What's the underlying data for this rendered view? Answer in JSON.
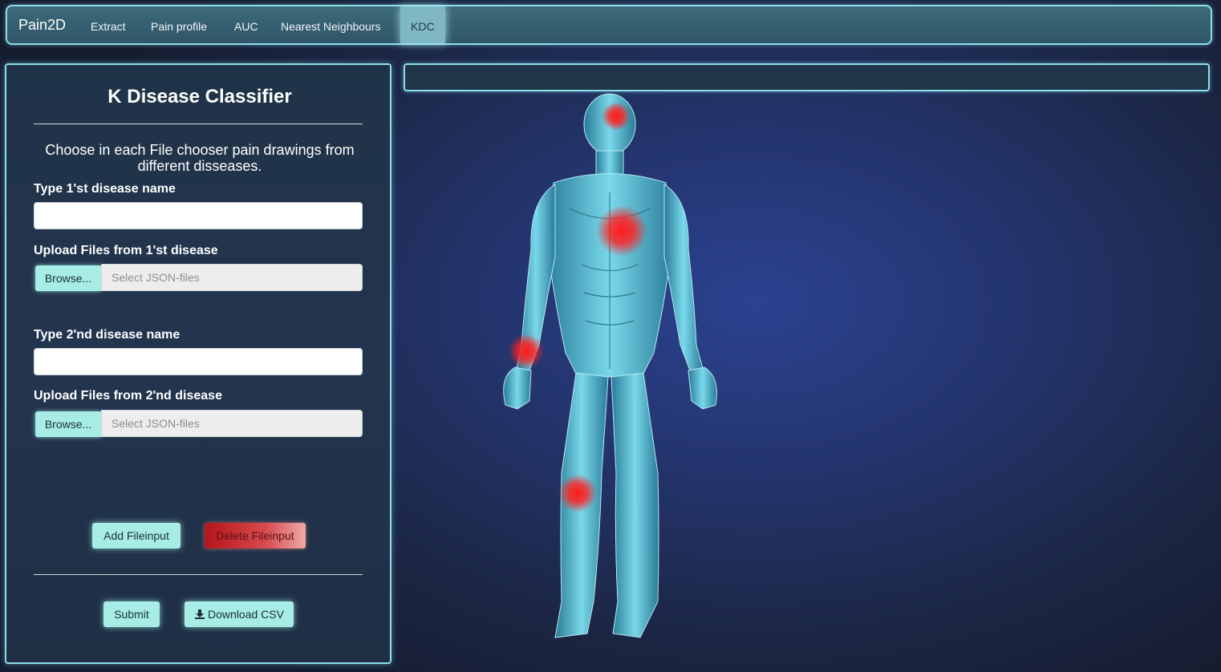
{
  "navbar": {
    "brand": "Pain2D",
    "items": [
      "Extract",
      "Pain profile",
      "AUC",
      "Nearest Neighbours",
      "KDC"
    ],
    "active": "KDC"
  },
  "panel": {
    "title": "K Disease Classifier",
    "description": "Choose in each File chooser pain drawings from different disseases.",
    "disease1_name_label": "Type 1'st disease name",
    "disease1_name_value": "",
    "disease1_upload_label": "Upload Files from 1'st disease",
    "disease2_name_label": "Type 2'nd disease name",
    "disease2_name_value": "",
    "disease2_upload_label": "Upload Files from 2'nd disease",
    "browse_label": "Browse...",
    "file_placeholder": "Select JSON-files",
    "add_fileinput": "Add Fileinput",
    "delete_fileinput": "Delete Fileinput",
    "submit": "Submit",
    "download_csv": "Download CSV"
  },
  "colors": {
    "accent": "#8fdde9",
    "button": "#a8ece6",
    "danger": "#b5141a",
    "pain_marker": "#ff1a1a"
  }
}
